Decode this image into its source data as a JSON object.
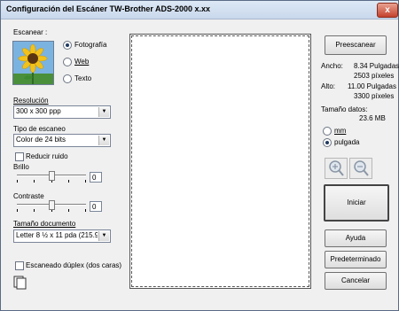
{
  "window": {
    "title": "Configuración del Escáner TW-Brother ADS-2000   x.xx",
    "close_glyph": "x"
  },
  "scan": {
    "label": "Escanear :",
    "options": [
      {
        "label": "Fotografía",
        "selected": true
      },
      {
        "label": "Web",
        "selected": false
      },
      {
        "label": "Texto",
        "selected": false
      }
    ]
  },
  "resolution": {
    "label": "Resolución",
    "value": "300 x 300 ppp"
  },
  "scan_type": {
    "label": "Tipo de escaneo",
    "value": "Color de 24 bits"
  },
  "noise": {
    "label": "Reducir ruido",
    "checked": false
  },
  "brightness": {
    "label": "Brillo",
    "value": "0"
  },
  "contrast": {
    "label": "Contraste",
    "value": "0"
  },
  "doc_size": {
    "label": "Tamaño documento",
    "value": "Letter 8 ½ x 11 pda (215.9"
  },
  "duplex": {
    "label": "Escaneado dúplex (dos caras)",
    "checked": false
  },
  "right": {
    "prescan_label": "Preescanear",
    "width_label": "Ancho:",
    "width_in": "8.34 Pulgadas",
    "width_px": "2503 píxeles",
    "height_label": "Alto:",
    "height_in": "11.00 Pulgadas",
    "height_px": "3300 píxeles",
    "datasize_label": "Tamaño datos:",
    "datasize_value": "23.6 MB",
    "units": [
      {
        "label": "mm",
        "selected": false
      },
      {
        "label": "pulgada",
        "selected": true
      }
    ],
    "start_label": "Iniciar",
    "help_label": "Ayuda",
    "default_label": "Predeterminado",
    "cancel_label": "Cancelar"
  },
  "colors": {
    "accent": "#203a60",
    "sun_petal": "#f2c21a",
    "sky": "#6aa6d8"
  }
}
